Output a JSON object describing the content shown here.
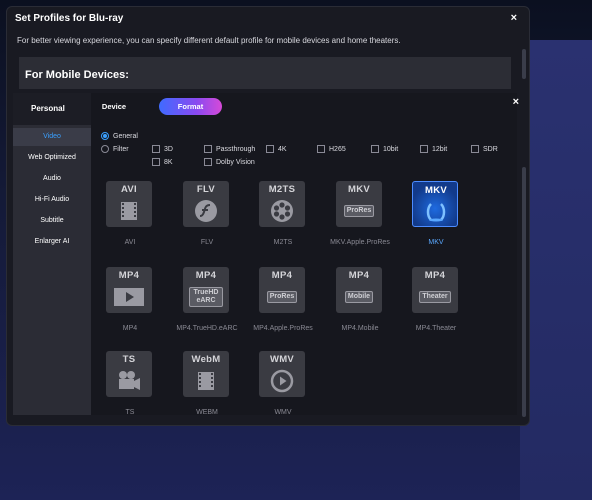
{
  "dialog": {
    "title": "Set Profiles for Blu-ray",
    "close_symbol": "×",
    "description": "For better viewing experience, you can specify different default profile for mobile devices and home theaters.",
    "section_heading": "For Mobile Devices:"
  },
  "sidebar": {
    "header": "Personal",
    "items": [
      {
        "label": "Video",
        "active": true
      },
      {
        "label": "Web Optimized"
      },
      {
        "label": "Audio"
      },
      {
        "label": "Hi-Fi Audio"
      },
      {
        "label": "Subtitle"
      },
      {
        "label": "Enlarger AI"
      }
    ]
  },
  "tabs": {
    "device": "Device",
    "format": "Format"
  },
  "options": {
    "general": "General",
    "filter": "Filter",
    "checkboxes": [
      "3D",
      "Passthrough",
      "4K",
      "H265",
      "10bit",
      "12bit",
      "SDR",
      "8K",
      "Dolby Vision"
    ]
  },
  "formats": [
    {
      "tag": "AVI",
      "name": "AVI",
      "icon": "film-strip-icon"
    },
    {
      "tag": "FLV",
      "name": "FLV",
      "icon": "flash-icon"
    },
    {
      "tag": "M2TS",
      "name": "M2TS",
      "icon": "film-reel-icon"
    },
    {
      "tag": "MKV",
      "sub": "ProRes",
      "name": "MKV.Apple.ProRes",
      "icon": "prores-icon"
    },
    {
      "tag": "MKV",
      "name": "MKV",
      "icon": "mkv-icon",
      "selected": true
    },
    {
      "tag": "MP4",
      "name": "MP4",
      "icon": "play-icon"
    },
    {
      "tag": "MP4",
      "sub": "TrueHD eARC",
      "name": "MP4.TrueHD.eARC",
      "icon": "truehd-icon"
    },
    {
      "tag": "MP4",
      "sub": "ProRes",
      "name": "MP4.Apple.ProRes",
      "icon": "prores-icon"
    },
    {
      "tag": "MP4",
      "sub": "Mobile",
      "name": "MP4.Mobile",
      "icon": "mobile-icon"
    },
    {
      "tag": "MP4",
      "sub": "Theater",
      "name": "MP4.Theater",
      "icon": "theater-icon"
    },
    {
      "tag": "TS",
      "name": "TS",
      "icon": "camera-icon"
    },
    {
      "tag": "WebM",
      "name": "WEBM",
      "icon": "film-strip-icon"
    },
    {
      "tag": "WMV",
      "name": "WMV",
      "icon": "play-circle-icon"
    }
  ],
  "colors": {
    "accent": "#3aa0ff",
    "format_tab_start": "#3f6bff",
    "format_tab_end": "#d64ad8",
    "selected_tile": "#1e6ae0"
  }
}
